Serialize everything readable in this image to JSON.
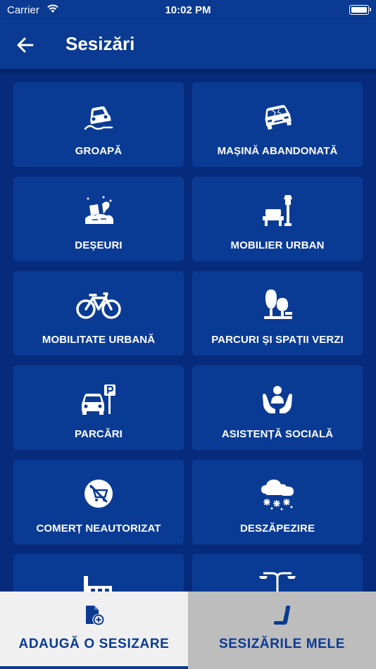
{
  "status_bar": {
    "carrier": "Carrier",
    "time": "10:02 PM"
  },
  "header": {
    "title": "Sesizări"
  },
  "categories": [
    {
      "label": "GROAPĂ",
      "icon": "pothole-car-icon"
    },
    {
      "label": "MAȘINĂ ABANDONATĂ",
      "icon": "abandoned-car-icon"
    },
    {
      "label": "DEȘEURI",
      "icon": "waste-icon"
    },
    {
      "label": "MOBILIER URBAN",
      "icon": "bench-lamp-icon"
    },
    {
      "label": "MOBILITATE URBANĂ",
      "icon": "bicycle-icon"
    },
    {
      "label": "PARCURI ȘI SPAȚII VERZI",
      "icon": "trees-icon"
    },
    {
      "label": "PARCĂRI",
      "icon": "parking-car-icon"
    },
    {
      "label": "ASISTENȚĂ SOCIALĂ",
      "icon": "helping-hands-icon"
    },
    {
      "label": "COMERȚ NEAUTORIZAT",
      "icon": "no-cart-icon"
    },
    {
      "label": "DESZĂPEZIRE",
      "icon": "snow-cloud-icon"
    },
    {
      "label": "",
      "icon": "building-icon"
    },
    {
      "label": "",
      "icon": "street-lamp-icon"
    }
  ],
  "tabs": [
    {
      "label": "ADAUGĂ O SESIZARE",
      "icon": "add-document-icon",
      "active": true
    },
    {
      "label": "SESIZĂRILE MELE",
      "icon": "scroll-icon",
      "active": false
    }
  ],
  "colors": {
    "brand_blue": "#0a3a92",
    "background": "#072b7c",
    "tile": "#0a3b94"
  }
}
